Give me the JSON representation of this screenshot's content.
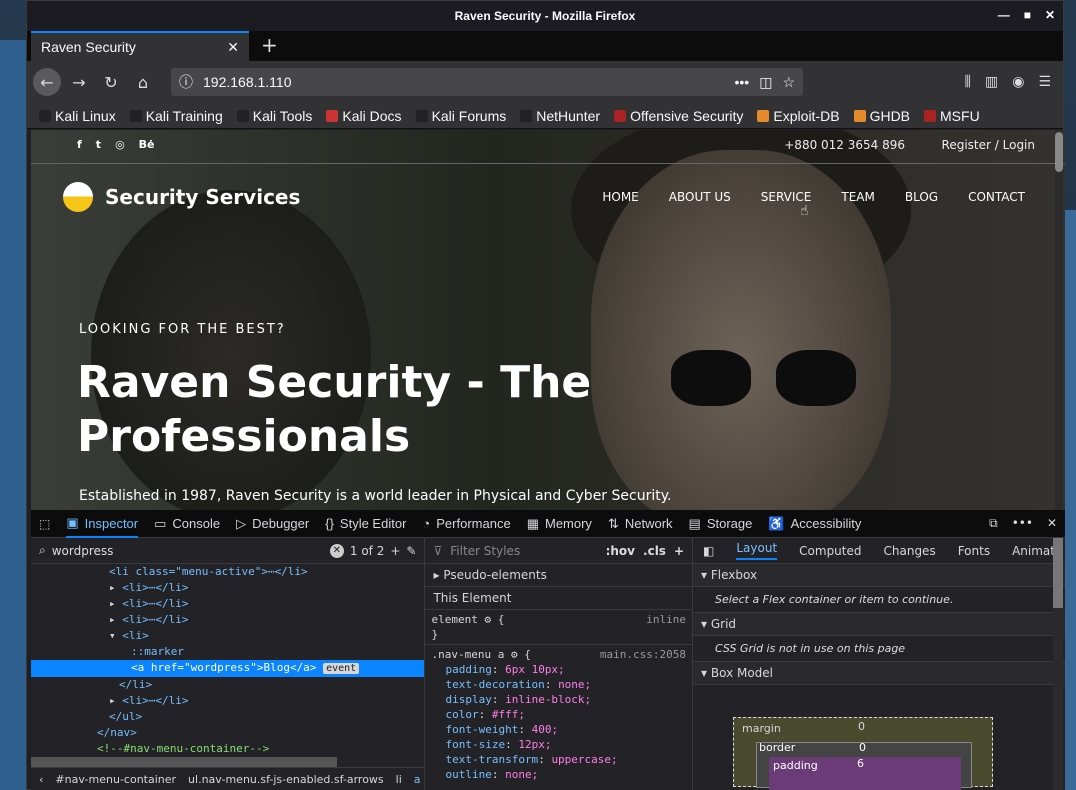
{
  "window": {
    "title": "Raven Security - Mozilla Firefox"
  },
  "tab": {
    "title": "Raven Security"
  },
  "nav": {
    "url": "192.168.1.110"
  },
  "bookmarks": [
    "Kali Linux",
    "Kali Training",
    "Kali Tools",
    "Kali Docs",
    "Kali Forums",
    "NetHunter",
    "Offensive Security",
    "Exploit-DB",
    "GHDB",
    "MSFU"
  ],
  "site": {
    "phone": "+880 012 3654 896",
    "register": "Register / Login",
    "social": [
      "f",
      "t",
      "◎",
      "Bė"
    ],
    "logo": "Security Services",
    "menu": [
      "HOME",
      "ABOUT US",
      "SERVICE",
      "TEAM",
      "BLOG",
      "CONTACT"
    ],
    "hero_sub": "LOOKING FOR THE BEST?",
    "hero_title": "Raven Security - The Professionals",
    "hero_desc": "Established in 1987, Raven Security is a world leader in Physical and Cyber Security."
  },
  "devtools": {
    "tabs": [
      "Inspector",
      "Console",
      "Debugger",
      "Style Editor",
      "Performance",
      "Memory",
      "Network",
      "Storage",
      "Accessibility"
    ],
    "search": "wordpress",
    "match": "1 of 2",
    "tree": [
      "<li class=\"menu-active\">⋯</li>",
      "<li>⋯</li>",
      "<li>⋯</li>",
      "<li>⋯</li>",
      "<li>",
      "::marker",
      "<a href=\"wordpress\">Blog</a>",
      "</li>",
      "<li>⋯</li>",
      "</ul>",
      "</nav>",
      "<!--#nav-menu-container-->"
    ],
    "event_badge": "event",
    "crumbs": [
      "#nav-menu-container",
      "ul.nav-menu.sf-js-enabled.sf-arrows",
      "li",
      "a"
    ],
    "filter_placeholder": "Filter Styles",
    "hov": ":hov",
    "cls": ".cls",
    "pseudo": "Pseudo-elements",
    "this_element": "This Element",
    "rule1_sel": "element",
    "rule1_src": "inline",
    "rule2_sel": ".nav-menu a",
    "rule2_src": "main.css:2058",
    "props": [
      {
        "n": "padding",
        "v": "6px 10px;"
      },
      {
        "n": "text-decoration",
        "v": "none;"
      },
      {
        "n": "display",
        "v": "inline-block;"
      },
      {
        "n": "color",
        "v": "#fff;"
      },
      {
        "n": "font-weight",
        "v": "400;"
      },
      {
        "n": "font-size",
        "v": "12px;"
      },
      {
        "n": "text-transform",
        "v": "uppercase;"
      },
      {
        "n": "outline",
        "v": "none;"
      }
    ],
    "layout_tabs": [
      "Layout",
      "Computed",
      "Changes",
      "Fonts",
      "Animat"
    ],
    "flexbox": "Flexbox",
    "flex_note": "Select a Flex container or item to continue.",
    "grid": "Grid",
    "grid_note": "CSS Grid is not in use on this page",
    "boxmodel": "Box Model",
    "bm_margin": "margin",
    "bm_border": "border",
    "bm_padding": "padding",
    "bm_m": "0",
    "bm_b": "0",
    "bm_p": "6"
  }
}
